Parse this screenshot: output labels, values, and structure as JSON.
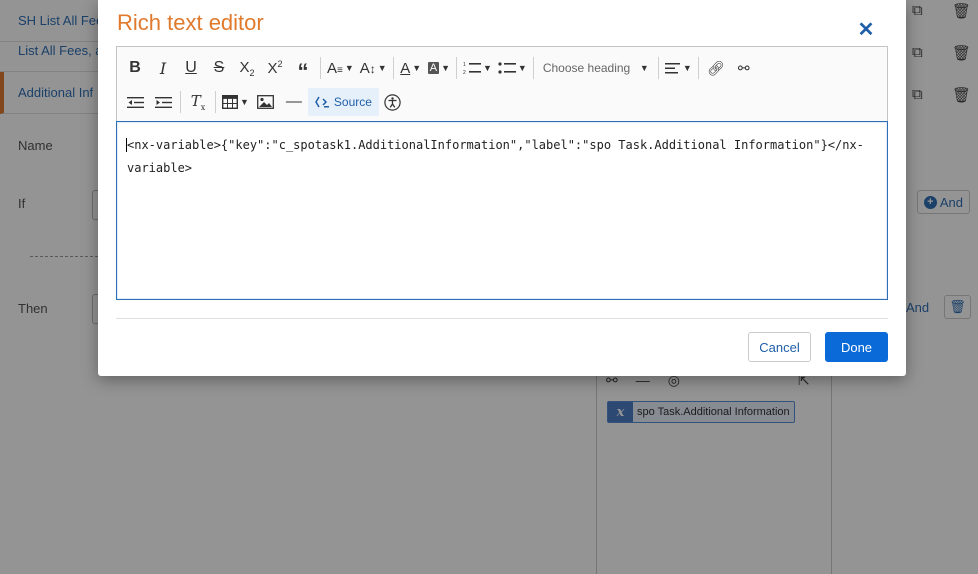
{
  "background": {
    "list_items": [
      "SH List All Fees",
      "List All Fees, a",
      "Additional Inf"
    ],
    "labels": {
      "name": "Name",
      "if": "If",
      "then": "Then"
    },
    "and_button": "And",
    "and_link": "And",
    "variable_chip": {
      "icon": "x",
      "label": "spo Task.Additional Information"
    }
  },
  "modal": {
    "title": "Rich text editor",
    "close_icon": "close-icon",
    "toolbar": {
      "heading_placeholder": "Choose heading",
      "source_label": "Source"
    },
    "content": {
      "line1": "<nx-variable>{\"key\":\"c_spotask1.AdditionalInformation\",\"label\":\"spo Task.Additional Information\"}</nx-",
      "line2": "variable>"
    },
    "buttons": {
      "cancel": "Cancel",
      "done": "Done"
    }
  },
  "colors": {
    "title": "#e07a2d",
    "primary": "#0a6ad8",
    "link": "#1f5fa8",
    "overlay": "rgba(0,0,0,0.42)"
  }
}
